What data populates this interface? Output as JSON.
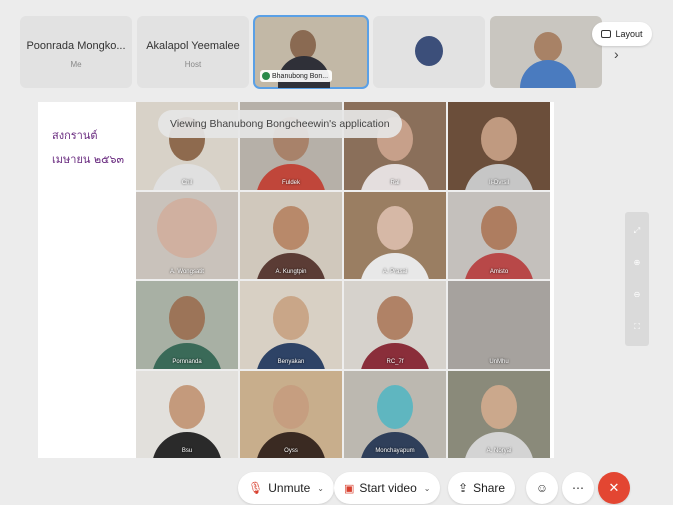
{
  "participants": [
    {
      "name": "Poonrada Mongko...",
      "role": "Me"
    },
    {
      "name": "Akalapol Yeemalee",
      "role": "Host"
    }
  ],
  "active_speaker": {
    "label": "Bhanubong Bon..."
  },
  "layout_button": {
    "label": "Layout"
  },
  "shared_content": {
    "title_line1": "สงกรานต์",
    "title_line2": "เมษายน ๒๕๖๓",
    "viewing_banner": "Viewing Bhanubong Bongcheewin's application",
    "grid_labels": [
      "Chil",
      "Fuldek",
      "Ral",
      "Ii-Dvrsil",
      "A. Wongsatit",
      "A. Kungtpin",
      "A. Prasai",
      "Amisto",
      "Pornnanda",
      "Benyakan",
      "RC_7f",
      "UnMhu",
      "Bsu",
      "Oyss",
      "Monchayapum",
      "A. Noryai"
    ]
  },
  "controls": {
    "unmute": "Unmute",
    "start_video": "Start video",
    "share": "Share"
  },
  "colors": {
    "end_button": "#e34632",
    "accent_purple": "#6a2c80",
    "active_border": "#5aa0e6"
  }
}
